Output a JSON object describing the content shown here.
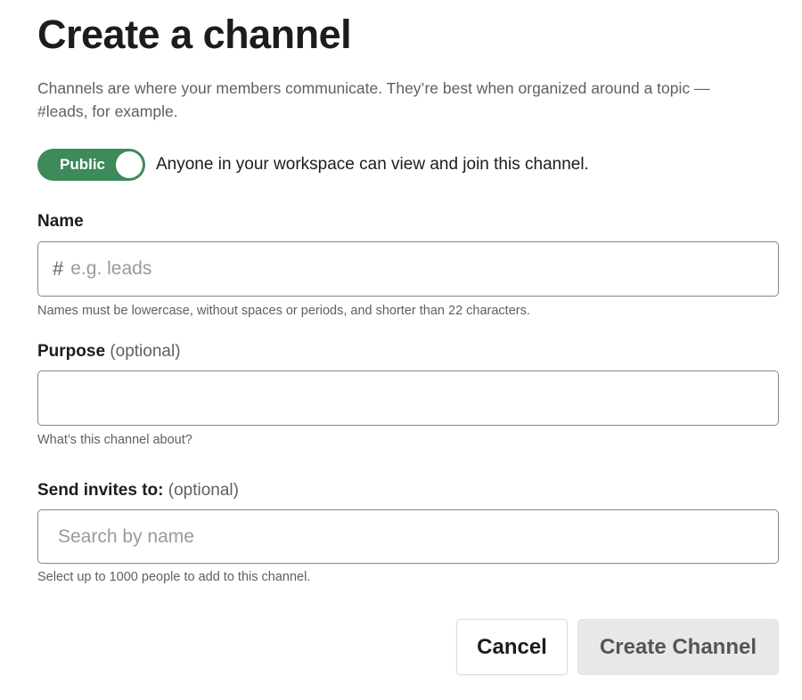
{
  "dialog": {
    "title": "Create a channel",
    "intro": "Channels are where your members communicate. They’re best when organized around a topic — #leads, for example."
  },
  "visibility": {
    "toggle_label": "Public",
    "state": "on",
    "description": "Anyone in your workspace can view and join this channel."
  },
  "name_field": {
    "label": "Name",
    "prefix": "#",
    "value": "",
    "placeholder": "e.g. leads",
    "hint": "Names must be lowercase, without spaces or periods, and shorter than 22 characters."
  },
  "purpose_field": {
    "label": "Purpose",
    "optional_text": "(optional)",
    "value": "",
    "placeholder": "",
    "hint": "What’s this channel about?"
  },
  "invites_field": {
    "label": "Send invites to:",
    "optional_text": "(optional)",
    "value": "",
    "placeholder": "Search by name",
    "hint": "Select up to 1000 people to add to this channel."
  },
  "actions": {
    "cancel_label": "Cancel",
    "create_label": "Create Channel"
  },
  "colors": {
    "toggle_on": "#3d8a5b",
    "create_disabled_bg": "#e8e8e8",
    "text_primary": "#1d1c1d",
    "text_secondary": "#616061"
  }
}
